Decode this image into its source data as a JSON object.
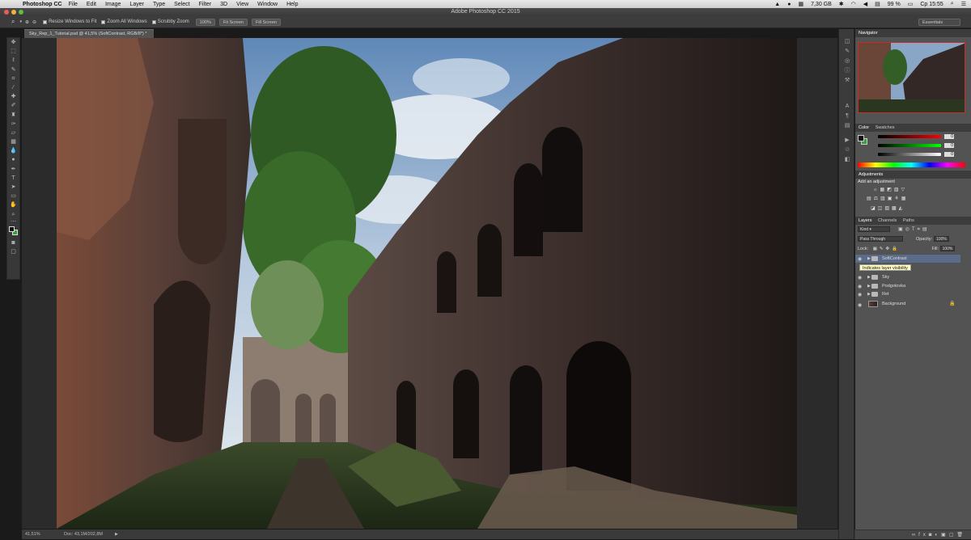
{
  "menubar": {
    "app_name": "Photoshop CC",
    "items": [
      "File",
      "Edit",
      "Image",
      "Layer",
      "Type",
      "Select",
      "Filter",
      "3D",
      "View",
      "Window",
      "Help"
    ],
    "memory": "7,30 GB",
    "battery": "99 %",
    "clock": "Ср 15:55"
  },
  "window": {
    "title": "Adobe Photoshop CC 2015"
  },
  "options_bar": {
    "resize_windows": "Resize Windows to Fit",
    "zoom_all": "Zoom All Windows",
    "scrubby_zoom": "Scrubby Zoom",
    "zoom_100": "100%",
    "fit_screen": "Fit Screen",
    "fill_screen": "Fill Screen",
    "workspace": "Essentials"
  },
  "document": {
    "tab_title": "Sky_Rep_1_Tutorial.psd @ 41,5% (SoftContrast, RGB/8*) *",
    "zoom": "41,51%",
    "doc_info": "Doc: 43,1M/202,8M"
  },
  "panels": {
    "navigator_tab": "Navigator",
    "color_tabs": [
      "Color",
      "Swatches"
    ],
    "color_values": [
      "0",
      "0",
      "0"
    ],
    "adjustments_tab": "Adjustments",
    "add_adjustment": "Add an adjustment",
    "layers_tabs": [
      "Layers",
      "Channels",
      "Paths"
    ],
    "kind_filter": "Kind",
    "blend_mode": "Pass Through",
    "opacity_label": "Opacity:",
    "opacity_value": "100%",
    "lock_label": "Lock:",
    "fill_label": "Fill:",
    "fill_value": "100%",
    "tooltip": "Indicates layer visibility",
    "layers": [
      {
        "name": "SoftContrast"
      },
      {
        "name": "Sky"
      },
      {
        "name": "Podgotovka"
      },
      {
        "name": "Ret"
      },
      {
        "name": "Background"
      }
    ]
  },
  "colors": {
    "panel_bg": "#535353",
    "selected_layer": "#5b6b8a",
    "tooltip_bg": "#fffcc4"
  }
}
